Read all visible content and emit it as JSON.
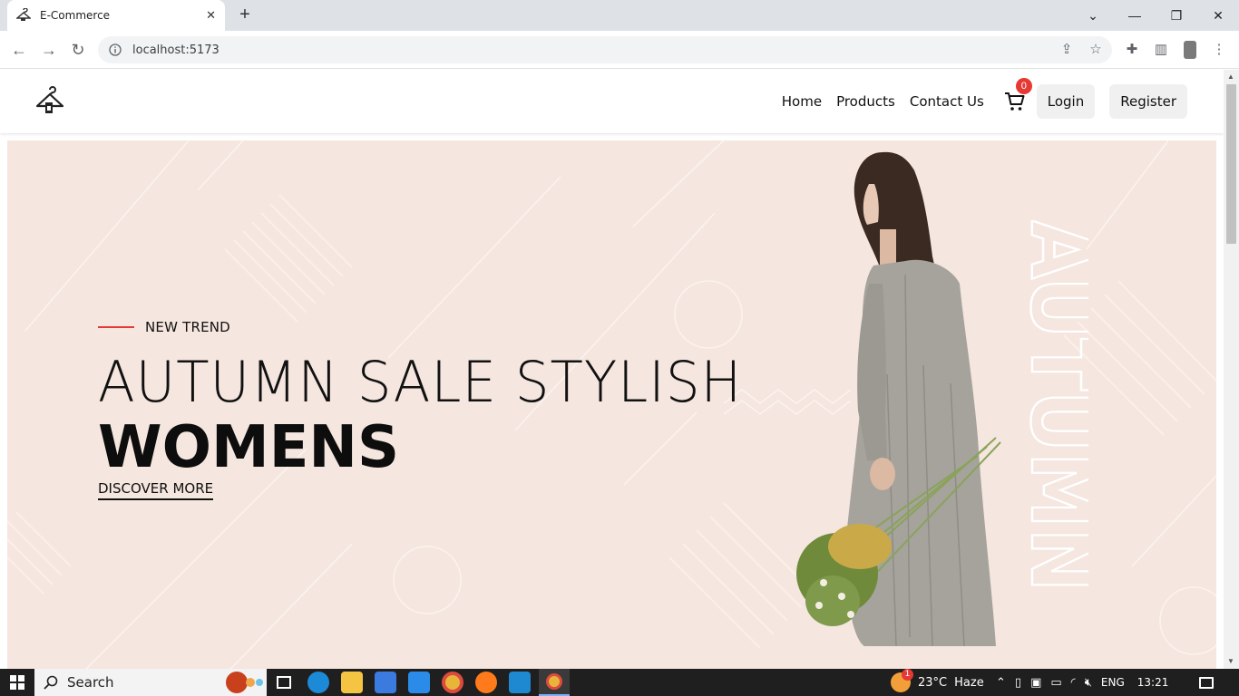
{
  "browser": {
    "tab_title": "E-Commerce",
    "url": "localhost:5173"
  },
  "site": {
    "nav": {
      "links": [
        "Home",
        "Products",
        "Contact Us"
      ],
      "cart_count": "0",
      "login_label": "Login",
      "register_label": "Register"
    },
    "hero": {
      "kicker": "NEW TREND",
      "headline_line1": "AUTUMN SALE STYLISH",
      "headline_line2": "WOMENS",
      "cta_label": "DISCOVER MORE",
      "vertical_text": "AUTUMN"
    }
  },
  "taskbar": {
    "search_placeholder": "Search",
    "weather_temp": "23°C",
    "weather_desc": "Haze",
    "weather_alert_count": "1",
    "language": "ENG",
    "time": "13:21"
  },
  "colors": {
    "hero_bg": "#f5e6df",
    "accent_red": "#e53935",
    "taskbar_bg": "#1f1f1f"
  }
}
